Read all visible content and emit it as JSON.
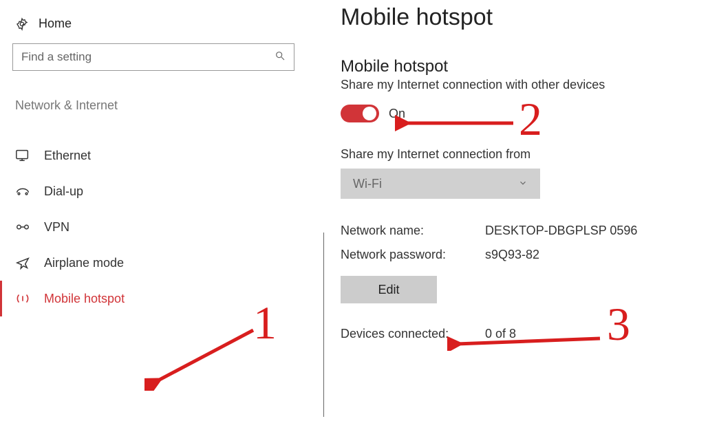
{
  "header": {
    "home": "Home",
    "search_placeholder": "Find a setting",
    "category": "Network & Internet"
  },
  "sidebar": {
    "items": [
      {
        "label": "Ethernet"
      },
      {
        "label": "Dial-up"
      },
      {
        "label": "VPN"
      },
      {
        "label": "Airplane mode"
      },
      {
        "label": "Mobile hotspot"
      }
    ]
  },
  "main": {
    "page_title": "Mobile hotspot",
    "section_title": "Mobile hotspot",
    "share_desc": "Share my Internet connection with other devices",
    "toggle_state": "On",
    "share_from_label": "Share my Internet connection from",
    "share_from_value": "Wi-Fi",
    "network_name_label": "Network name:",
    "network_name_value": "DESKTOP-DBGPLSP 0596",
    "network_password_label": "Network password:",
    "network_password_value": "s9Q93-82",
    "edit_label": "Edit",
    "devices_label": "Devices connected:",
    "devices_value": "0 of 8"
  },
  "annotations": {
    "n1": "1",
    "n2": "2",
    "n3": "3"
  }
}
